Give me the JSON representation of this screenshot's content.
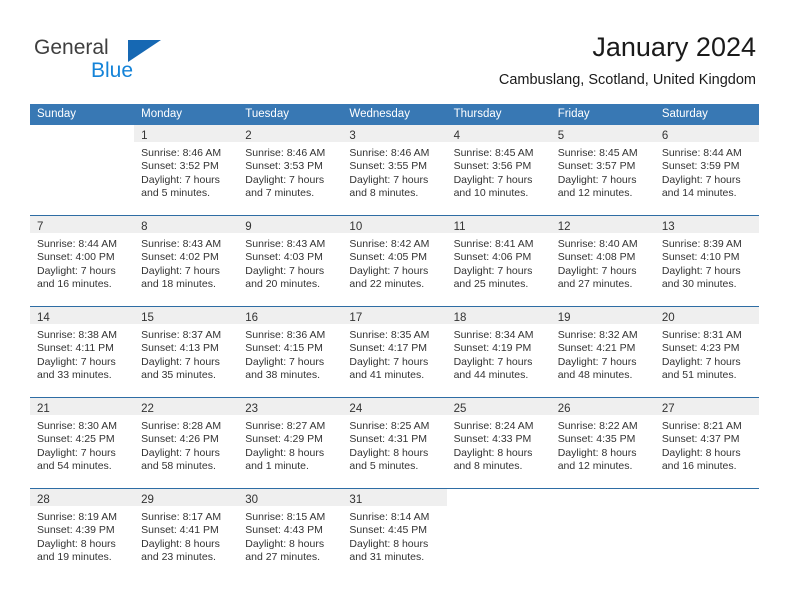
{
  "brand": {
    "name_primary": "General",
    "name_secondary": "Blue",
    "triangle_color": "#1668b3",
    "blue_text_color": "#1483d8"
  },
  "header": {
    "title": "January 2024",
    "location": "Cambuslang, Scotland, United Kingdom",
    "header_bg_color": "#3878b4",
    "row_divider_color": "#2e6da4",
    "daynum_band_color": "#efefef"
  },
  "weekday_headers": [
    "Sunday",
    "Monday",
    "Tuesday",
    "Wednesday",
    "Thursday",
    "Friday",
    "Saturday"
  ],
  "labels": {
    "sunrise_prefix": "Sunrise:",
    "sunset_prefix": "Sunset:",
    "daylight_prefix": "Daylight:"
  },
  "weeks": [
    [
      {
        "day": "",
        "line1": "",
        "line2": "",
        "line3": "",
        "line4": ""
      },
      {
        "day": "1",
        "line1": "Sunrise: 8:46 AM",
        "line2": "Sunset: 3:52 PM",
        "line3": "Daylight: 7 hours",
        "line4": "and 5 minutes."
      },
      {
        "day": "2",
        "line1": "Sunrise: 8:46 AM",
        "line2": "Sunset: 3:53 PM",
        "line3": "Daylight: 7 hours",
        "line4": "and 7 minutes."
      },
      {
        "day": "3",
        "line1": "Sunrise: 8:46 AM",
        "line2": "Sunset: 3:55 PM",
        "line3": "Daylight: 7 hours",
        "line4": "and 8 minutes."
      },
      {
        "day": "4",
        "line1": "Sunrise: 8:45 AM",
        "line2": "Sunset: 3:56 PM",
        "line3": "Daylight: 7 hours",
        "line4": "and 10 minutes."
      },
      {
        "day": "5",
        "line1": "Sunrise: 8:45 AM",
        "line2": "Sunset: 3:57 PM",
        "line3": "Daylight: 7 hours",
        "line4": "and 12 minutes."
      },
      {
        "day": "6",
        "line1": "Sunrise: 8:44 AM",
        "line2": "Sunset: 3:59 PM",
        "line3": "Daylight: 7 hours",
        "line4": "and 14 minutes."
      }
    ],
    [
      {
        "day": "7",
        "line1": "Sunrise: 8:44 AM",
        "line2": "Sunset: 4:00 PM",
        "line3": "Daylight: 7 hours",
        "line4": "and 16 minutes."
      },
      {
        "day": "8",
        "line1": "Sunrise: 8:43 AM",
        "line2": "Sunset: 4:02 PM",
        "line3": "Daylight: 7 hours",
        "line4": "and 18 minutes."
      },
      {
        "day": "9",
        "line1": "Sunrise: 8:43 AM",
        "line2": "Sunset: 4:03 PM",
        "line3": "Daylight: 7 hours",
        "line4": "and 20 minutes."
      },
      {
        "day": "10",
        "line1": "Sunrise: 8:42 AM",
        "line2": "Sunset: 4:05 PM",
        "line3": "Daylight: 7 hours",
        "line4": "and 22 minutes."
      },
      {
        "day": "11",
        "line1": "Sunrise: 8:41 AM",
        "line2": "Sunset: 4:06 PM",
        "line3": "Daylight: 7 hours",
        "line4": "and 25 minutes."
      },
      {
        "day": "12",
        "line1": "Sunrise: 8:40 AM",
        "line2": "Sunset: 4:08 PM",
        "line3": "Daylight: 7 hours",
        "line4": "and 27 minutes."
      },
      {
        "day": "13",
        "line1": "Sunrise: 8:39 AM",
        "line2": "Sunset: 4:10 PM",
        "line3": "Daylight: 7 hours",
        "line4": "and 30 minutes."
      }
    ],
    [
      {
        "day": "14",
        "line1": "Sunrise: 8:38 AM",
        "line2": "Sunset: 4:11 PM",
        "line3": "Daylight: 7 hours",
        "line4": "and 33 minutes."
      },
      {
        "day": "15",
        "line1": "Sunrise: 8:37 AM",
        "line2": "Sunset: 4:13 PM",
        "line3": "Daylight: 7 hours",
        "line4": "and 35 minutes."
      },
      {
        "day": "16",
        "line1": "Sunrise: 8:36 AM",
        "line2": "Sunset: 4:15 PM",
        "line3": "Daylight: 7 hours",
        "line4": "and 38 minutes."
      },
      {
        "day": "17",
        "line1": "Sunrise: 8:35 AM",
        "line2": "Sunset: 4:17 PM",
        "line3": "Daylight: 7 hours",
        "line4": "and 41 minutes."
      },
      {
        "day": "18",
        "line1": "Sunrise: 8:34 AM",
        "line2": "Sunset: 4:19 PM",
        "line3": "Daylight: 7 hours",
        "line4": "and 44 minutes."
      },
      {
        "day": "19",
        "line1": "Sunrise: 8:32 AM",
        "line2": "Sunset: 4:21 PM",
        "line3": "Daylight: 7 hours",
        "line4": "and 48 minutes."
      },
      {
        "day": "20",
        "line1": "Sunrise: 8:31 AM",
        "line2": "Sunset: 4:23 PM",
        "line3": "Daylight: 7 hours",
        "line4": "and 51 minutes."
      }
    ],
    [
      {
        "day": "21",
        "line1": "Sunrise: 8:30 AM",
        "line2": "Sunset: 4:25 PM",
        "line3": "Daylight: 7 hours",
        "line4": "and 54 minutes."
      },
      {
        "day": "22",
        "line1": "Sunrise: 8:28 AM",
        "line2": "Sunset: 4:26 PM",
        "line3": "Daylight: 7 hours",
        "line4": "and 58 minutes."
      },
      {
        "day": "23",
        "line1": "Sunrise: 8:27 AM",
        "line2": "Sunset: 4:29 PM",
        "line3": "Daylight: 8 hours",
        "line4": "and 1 minute."
      },
      {
        "day": "24",
        "line1": "Sunrise: 8:25 AM",
        "line2": "Sunset: 4:31 PM",
        "line3": "Daylight: 8 hours",
        "line4": "and 5 minutes."
      },
      {
        "day": "25",
        "line1": "Sunrise: 8:24 AM",
        "line2": "Sunset: 4:33 PM",
        "line3": "Daylight: 8 hours",
        "line4": "and 8 minutes."
      },
      {
        "day": "26",
        "line1": "Sunrise: 8:22 AM",
        "line2": "Sunset: 4:35 PM",
        "line3": "Daylight: 8 hours",
        "line4": "and 12 minutes."
      },
      {
        "day": "27",
        "line1": "Sunrise: 8:21 AM",
        "line2": "Sunset: 4:37 PM",
        "line3": "Daylight: 8 hours",
        "line4": "and 16 minutes."
      }
    ],
    [
      {
        "day": "28",
        "line1": "Sunrise: 8:19 AM",
        "line2": "Sunset: 4:39 PM",
        "line3": "Daylight: 8 hours",
        "line4": "and 19 minutes."
      },
      {
        "day": "29",
        "line1": "Sunrise: 8:17 AM",
        "line2": "Sunset: 4:41 PM",
        "line3": "Daylight: 8 hours",
        "line4": "and 23 minutes."
      },
      {
        "day": "30",
        "line1": "Sunrise: 8:15 AM",
        "line2": "Sunset: 4:43 PM",
        "line3": "Daylight: 8 hours",
        "line4": "and 27 minutes."
      },
      {
        "day": "31",
        "line1": "Sunrise: 8:14 AM",
        "line2": "Sunset: 4:45 PM",
        "line3": "Daylight: 8 hours",
        "line4": "and 31 minutes."
      },
      {
        "day": "",
        "line1": "",
        "line2": "",
        "line3": "",
        "line4": ""
      },
      {
        "day": "",
        "line1": "",
        "line2": "",
        "line3": "",
        "line4": ""
      },
      {
        "day": "",
        "line1": "",
        "line2": "",
        "line3": "",
        "line4": ""
      }
    ]
  ]
}
